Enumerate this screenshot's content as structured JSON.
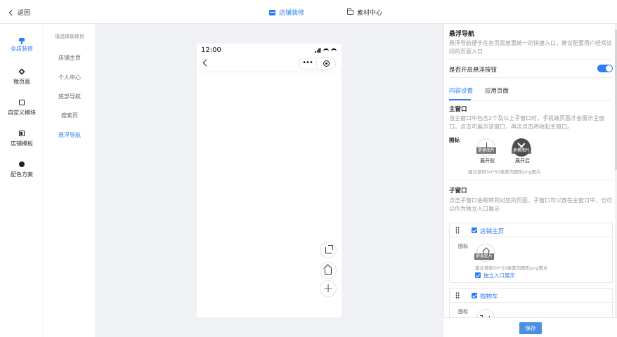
{
  "topbar": {
    "back_label": "返回",
    "tabs": [
      {
        "label": "店铺装修",
        "icon": "shop-icon",
        "active": true
      },
      {
        "label": "素材中心",
        "icon": "folder-icon",
        "active": false
      }
    ]
  },
  "leftnav": {
    "items": [
      {
        "label": "全店装修",
        "icon": "brush-icon",
        "active": true
      },
      {
        "label": "微页面",
        "icon": "layers-icon",
        "active": false
      },
      {
        "label": "自定义模块",
        "icon": "module-icon",
        "active": false
      },
      {
        "label": "店铺模板",
        "icon": "template-icon",
        "active": false
      },
      {
        "label": "配色方案",
        "icon": "palette-icon",
        "active": false
      }
    ]
  },
  "subnav": {
    "title": "请选择装修页",
    "items": [
      {
        "label": "店铺主页",
        "active": false
      },
      {
        "label": "个人中心",
        "active": false
      },
      {
        "label": "底部导航",
        "active": false
      },
      {
        "label": "搜索页",
        "active": false
      },
      {
        "label": "悬浮导航",
        "active": true
      }
    ]
  },
  "phone": {
    "time": "12:00",
    "capsule_dots": "•••",
    "fabs": [
      "share-icon",
      "home-icon",
      "plus-icon"
    ]
  },
  "panel": {
    "title": "悬浮导航",
    "desc": "悬浮导航便于在各页面放置统一的快捷入口，建议配置用户经常访问的页面入口",
    "toggle_label": "是否开启悬浮按钮",
    "toggle_on": true,
    "tabs": [
      {
        "label": "内容设置",
        "active": true
      },
      {
        "label": "应用页面",
        "active": false
      }
    ],
    "main_window": {
      "title": "主窗口",
      "desc": "当主窗口中包含2个及以上子窗口时，手机端页面才会展示主窗口，点击可展示该窗口，再次点击将收起主窗口。",
      "icon_label": "图标",
      "before_label": "展开前",
      "after_label": "展开后",
      "change_image": "更换图片",
      "hint": "建议使用50*50像素的圆形png图片"
    },
    "sub_window": {
      "title": "子窗口",
      "desc": "点击子窗口会跳转到对应的页面，子窗口可以放在主窗口中，也可以作为独立入口展示",
      "items": [
        {
          "name": "店铺主页",
          "icon_label": "图标",
          "change_image": "更换图片",
          "hint": "建议使用50*50像素的圆形png图片",
          "independent_label": "独立入口展示",
          "checked": true
        },
        {
          "name": "购物车",
          "icon_label": "图标",
          "checked": true
        }
      ]
    },
    "save_label": "保存"
  },
  "colors": {
    "accent": "#2d7ef0",
    "canvas_bg": "#f0f1f4",
    "save_button": "#4a90e2"
  }
}
